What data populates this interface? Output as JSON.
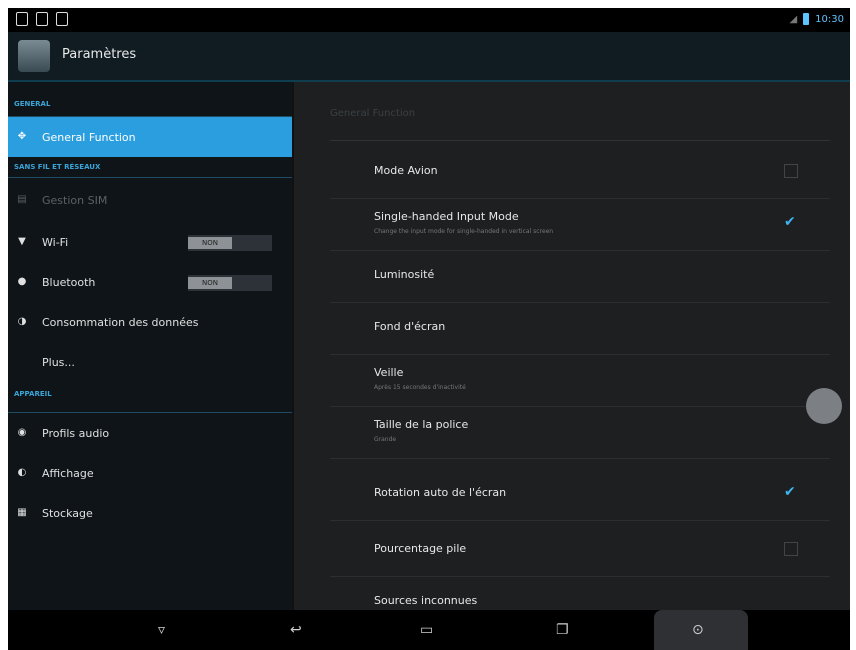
{
  "app": {
    "title": "Paramètres"
  },
  "status": {
    "time": "10:30"
  },
  "sidebar": {
    "sections": [
      {
        "header": "GENERAL"
      },
      {
        "header": "SANS FIL ET RÉSEAUX"
      },
      {
        "header": "APPAREIL"
      }
    ],
    "items": [
      {
        "label": "General Function",
        "icon": "gear-icon"
      },
      {
        "label": "Gestion SIM",
        "icon": "sim-icon"
      },
      {
        "label": "Wi-Fi",
        "icon": "wifi-icon",
        "toggle": "NON"
      },
      {
        "label": "Bluetooth",
        "icon": "bluetooth-icon",
        "toggle": "NON"
      },
      {
        "label": "Consommation des données",
        "icon": "data-usage-icon"
      },
      {
        "label": "Plus..."
      },
      {
        "label": "Profils audio",
        "icon": "audio-icon"
      },
      {
        "label": "Affichage",
        "icon": "display-icon"
      },
      {
        "label": "Stockage",
        "icon": "storage-icon"
      }
    ]
  },
  "main": {
    "header": "General Function",
    "rows": [
      {
        "title": "Mode Avion",
        "checked": false
      },
      {
        "title": "Single-handed Input Mode",
        "subtitle": "Change the input mode for single-handed in vertical screen",
        "checked": true
      },
      {
        "title": "Luminosité"
      },
      {
        "title": "Fond d'écran"
      },
      {
        "title": "Veille",
        "subtitle": "Après 15 secondes d'inactivité"
      },
      {
        "title": "Taille de la police",
        "subtitle": "Grande"
      },
      {
        "title": "Rotation auto de l'écran",
        "checked": true
      },
      {
        "title": "Pourcentage pile",
        "checked": false
      },
      {
        "title": "Sources inconnues"
      }
    ]
  },
  "navbar": {
    "buttons": [
      "hide-keyboard-icon",
      "back-icon",
      "home-icon",
      "recent-apps-icon",
      "screenshot-icon"
    ]
  },
  "colors": {
    "accent": "#2b9ee0",
    "background": "#1d1f21",
    "sidebar": "#0e1418"
  }
}
